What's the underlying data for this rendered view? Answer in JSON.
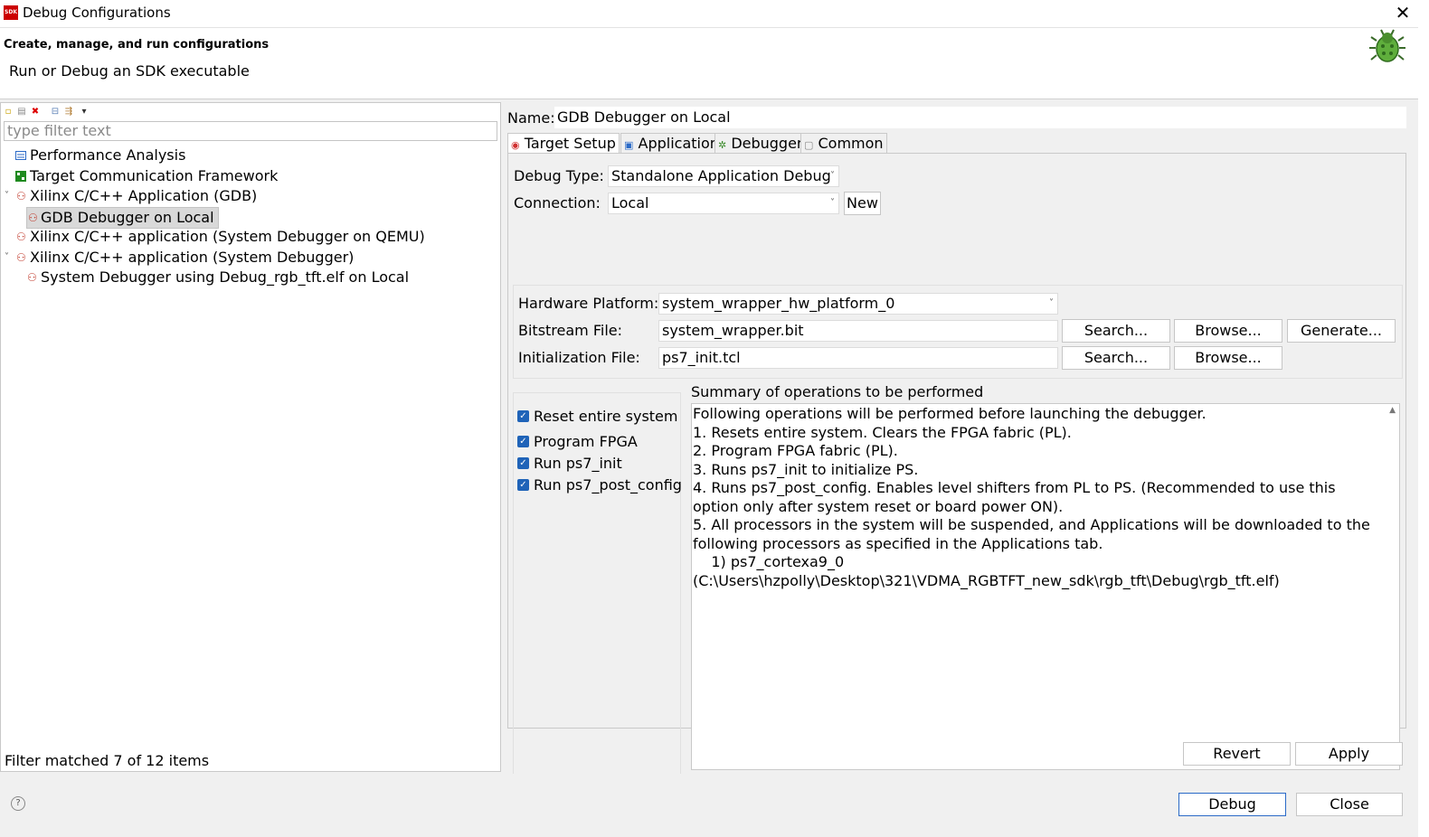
{
  "window": {
    "title": "Debug Configurations",
    "app_badge": "SDK"
  },
  "header": {
    "title": "Create, manage, and run configurations",
    "subtitle": "Run or Debug an SDK executable"
  },
  "left": {
    "filter_placeholder": "type filter text",
    "tree": [
      {
        "label": "Performance Analysis"
      },
      {
        "label": "Target Communication Framework"
      },
      {
        "label": "Xilinx C/C++ Application (GDB)",
        "expanded": true
      },
      {
        "label": "GDB Debugger on Local",
        "selected": true
      },
      {
        "label": "Xilinx C/C++ application (System Debugger on QEMU)"
      },
      {
        "label": "Xilinx C/C++ application (System Debugger)",
        "expanded": true
      },
      {
        "label": "System Debugger using Debug_rgb_tft.elf on Local"
      }
    ],
    "filter_status": "Filter matched 7 of 12 items"
  },
  "right": {
    "name_label": "Name:",
    "name_value": "GDB Debugger on Local",
    "tabs": [
      {
        "label": "Target Setup",
        "active": true
      },
      {
        "label": "Application"
      },
      {
        "label": "Debugger"
      },
      {
        "label": "Common"
      }
    ],
    "debug_type_label": "Debug Type:",
    "debug_type_value": "Standalone Application Debug",
    "connection_label": "Connection:",
    "connection_value": "Local",
    "new_button": "New",
    "hw_platform_label": "Hardware Platform:",
    "hw_platform_value": "system_wrapper_hw_platform_0",
    "bitstream_label": "Bitstream File:",
    "bitstream_value": "system_wrapper.bit",
    "init_label": "Initialization File:",
    "init_value": "ps7_init.tcl",
    "search_button": "Search...",
    "browse_button": "Browse...",
    "generate_button": "Generate...",
    "checkboxes": [
      {
        "label": "Reset entire system",
        "checked": true
      },
      {
        "label": "Program FPGA",
        "checked": true
      },
      {
        "label": "Run ps7_init",
        "checked": true
      },
      {
        "label": "Run ps7_post_config",
        "checked": true
      }
    ],
    "summary_title": "Summary of operations to be performed",
    "summary_text": "Following operations will be performed before launching the debugger.\n1. Resets entire system. Clears the FPGA fabric (PL).\n2. Program FPGA fabric (PL).\n3. Runs ps7_init to initialize PS.\n4. Runs ps7_post_config. Enables level shifters from PL to PS. (Recommended to use this option only after system reset or board power ON).\n5. All processors in the system will be suspended, and Applications will be downloaded to the following processors as specified in the Applications tab.\n    1) ps7_cortexa9_0\n(C:\\Users\\hzpolly\\Desktop\\321\\VDMA_RGBTFT_new_sdk\\rgb_tft\\Debug\\rgb_tft.elf)",
    "revert_button": "Revert",
    "apply_button": "Apply"
  },
  "footer": {
    "debug_button": "Debug",
    "close_button": "Close",
    "help_glyph": "?"
  },
  "colors": {
    "selection": "#d9d9d9",
    "checkbox": "#1f63b8",
    "default_button_border": "#2b6ac7"
  }
}
